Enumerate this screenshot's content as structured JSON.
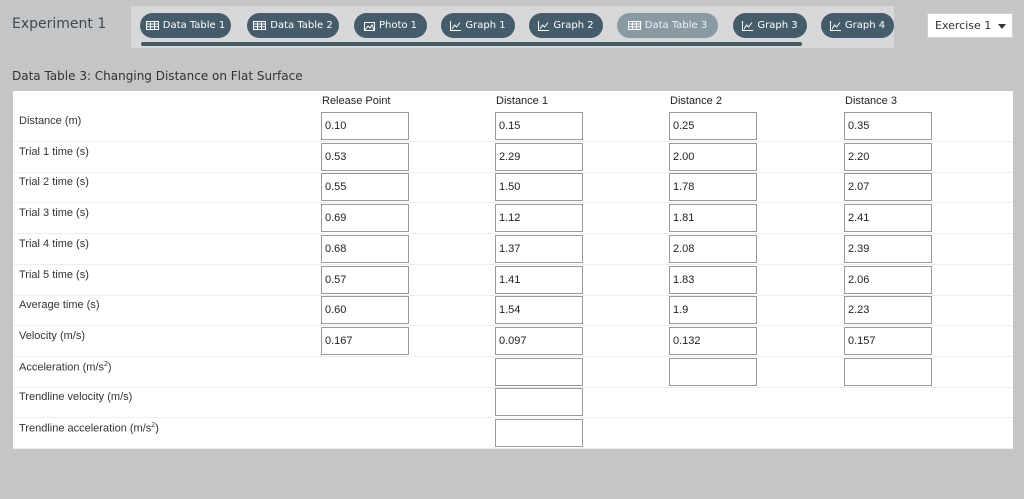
{
  "experiment_title": "Experiment 1",
  "tabs": [
    {
      "label": "Data Table 1",
      "icon": "table-icon",
      "active": false
    },
    {
      "label": "Data Table 2",
      "icon": "table-icon",
      "active": false
    },
    {
      "label": "Photo 1",
      "icon": "image-icon",
      "active": false
    },
    {
      "label": "Graph 1",
      "icon": "graph-icon",
      "active": false
    },
    {
      "label": "Graph 2",
      "icon": "graph-icon",
      "active": false
    },
    {
      "label": "Data Table 3",
      "icon": "table-icon",
      "active": true
    },
    {
      "label": "Graph 3",
      "icon": "graph-icon",
      "active": false
    },
    {
      "label": "Graph 4",
      "icon": "graph-icon",
      "active": false
    }
  ],
  "exercise_select": {
    "value": "Exercise 1"
  },
  "table": {
    "title": "Data Table 3: Changing Distance on Flat Surface",
    "columns": [
      "Release Point",
      "Distance 1",
      "Distance 2",
      "Distance 3"
    ],
    "rows": [
      {
        "label": "Distance (m)",
        "values": [
          "0.10",
          "0.15",
          "0.25",
          "0.35"
        ]
      },
      {
        "label": "Trial 1 time (s)",
        "values": [
          "0.53",
          "2.29",
          "2.00",
          "2.20"
        ]
      },
      {
        "label": "Trial 2 time (s)",
        "values": [
          "0.55",
          "1.50",
          "1.78",
          "2.07"
        ]
      },
      {
        "label": "Trial 3 time (s)",
        "values": [
          "0.69",
          "1.12",
          "1.81",
          "2.41"
        ]
      },
      {
        "label": "Trial 4 time (s)",
        "values": [
          "0.68",
          "1.37",
          "2.08",
          "2.39"
        ]
      },
      {
        "label": "Trial 5 time (s)",
        "values": [
          "0.57",
          "1.41",
          "1.83",
          "2.06"
        ]
      },
      {
        "label": "Average time (s)",
        "values": [
          "0.60",
          "1.54",
          "1.9",
          "2.23"
        ]
      },
      {
        "label": "Velocity (m/s)",
        "values": [
          "0.167",
          "0.097",
          "0.132",
          "0.157"
        ]
      },
      {
        "label": "Acceleration (m/s",
        "sup": "2",
        "suffix": ")",
        "values": [
          null,
          "",
          "",
          ""
        ]
      },
      {
        "label": "Trendline velocity (m/s)",
        "values": [
          null,
          "",
          null,
          null
        ]
      },
      {
        "label": "Trendline acceleration (m/s",
        "sup": "2",
        "suffix": ")",
        "values": [
          null,
          "",
          null,
          null
        ]
      }
    ]
  },
  "colors": {
    "tab": "#455d6a",
    "tab_active": "#8a9aa2",
    "background": "#c3c5c7"
  }
}
